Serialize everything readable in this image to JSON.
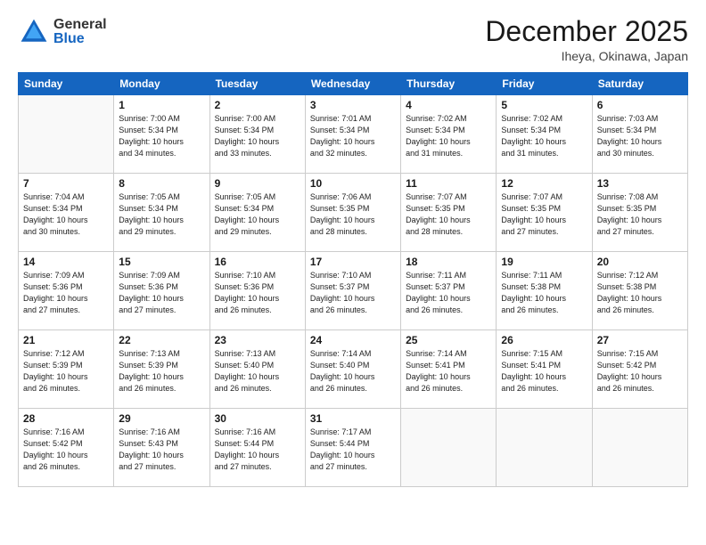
{
  "header": {
    "logo_general": "General",
    "logo_blue": "Blue",
    "month": "December 2025",
    "location": "Iheya, Okinawa, Japan"
  },
  "days_of_week": [
    "Sunday",
    "Monday",
    "Tuesday",
    "Wednesday",
    "Thursday",
    "Friday",
    "Saturday"
  ],
  "weeks": [
    [
      {
        "day": "",
        "info": ""
      },
      {
        "day": "1",
        "info": "Sunrise: 7:00 AM\nSunset: 5:34 PM\nDaylight: 10 hours\nand 34 minutes."
      },
      {
        "day": "2",
        "info": "Sunrise: 7:00 AM\nSunset: 5:34 PM\nDaylight: 10 hours\nand 33 minutes."
      },
      {
        "day": "3",
        "info": "Sunrise: 7:01 AM\nSunset: 5:34 PM\nDaylight: 10 hours\nand 32 minutes."
      },
      {
        "day": "4",
        "info": "Sunrise: 7:02 AM\nSunset: 5:34 PM\nDaylight: 10 hours\nand 31 minutes."
      },
      {
        "day": "5",
        "info": "Sunrise: 7:02 AM\nSunset: 5:34 PM\nDaylight: 10 hours\nand 31 minutes."
      },
      {
        "day": "6",
        "info": "Sunrise: 7:03 AM\nSunset: 5:34 PM\nDaylight: 10 hours\nand 30 minutes."
      }
    ],
    [
      {
        "day": "7",
        "info": "Sunrise: 7:04 AM\nSunset: 5:34 PM\nDaylight: 10 hours\nand 30 minutes."
      },
      {
        "day": "8",
        "info": "Sunrise: 7:05 AM\nSunset: 5:34 PM\nDaylight: 10 hours\nand 29 minutes."
      },
      {
        "day": "9",
        "info": "Sunrise: 7:05 AM\nSunset: 5:34 PM\nDaylight: 10 hours\nand 29 minutes."
      },
      {
        "day": "10",
        "info": "Sunrise: 7:06 AM\nSunset: 5:35 PM\nDaylight: 10 hours\nand 28 minutes."
      },
      {
        "day": "11",
        "info": "Sunrise: 7:07 AM\nSunset: 5:35 PM\nDaylight: 10 hours\nand 28 minutes."
      },
      {
        "day": "12",
        "info": "Sunrise: 7:07 AM\nSunset: 5:35 PM\nDaylight: 10 hours\nand 27 minutes."
      },
      {
        "day": "13",
        "info": "Sunrise: 7:08 AM\nSunset: 5:35 PM\nDaylight: 10 hours\nand 27 minutes."
      }
    ],
    [
      {
        "day": "14",
        "info": "Sunrise: 7:09 AM\nSunset: 5:36 PM\nDaylight: 10 hours\nand 27 minutes."
      },
      {
        "day": "15",
        "info": "Sunrise: 7:09 AM\nSunset: 5:36 PM\nDaylight: 10 hours\nand 27 minutes."
      },
      {
        "day": "16",
        "info": "Sunrise: 7:10 AM\nSunset: 5:36 PM\nDaylight: 10 hours\nand 26 minutes."
      },
      {
        "day": "17",
        "info": "Sunrise: 7:10 AM\nSunset: 5:37 PM\nDaylight: 10 hours\nand 26 minutes."
      },
      {
        "day": "18",
        "info": "Sunrise: 7:11 AM\nSunset: 5:37 PM\nDaylight: 10 hours\nand 26 minutes."
      },
      {
        "day": "19",
        "info": "Sunrise: 7:11 AM\nSunset: 5:38 PM\nDaylight: 10 hours\nand 26 minutes."
      },
      {
        "day": "20",
        "info": "Sunrise: 7:12 AM\nSunset: 5:38 PM\nDaylight: 10 hours\nand 26 minutes."
      }
    ],
    [
      {
        "day": "21",
        "info": "Sunrise: 7:12 AM\nSunset: 5:39 PM\nDaylight: 10 hours\nand 26 minutes."
      },
      {
        "day": "22",
        "info": "Sunrise: 7:13 AM\nSunset: 5:39 PM\nDaylight: 10 hours\nand 26 minutes."
      },
      {
        "day": "23",
        "info": "Sunrise: 7:13 AM\nSunset: 5:40 PM\nDaylight: 10 hours\nand 26 minutes."
      },
      {
        "day": "24",
        "info": "Sunrise: 7:14 AM\nSunset: 5:40 PM\nDaylight: 10 hours\nand 26 minutes."
      },
      {
        "day": "25",
        "info": "Sunrise: 7:14 AM\nSunset: 5:41 PM\nDaylight: 10 hours\nand 26 minutes."
      },
      {
        "day": "26",
        "info": "Sunrise: 7:15 AM\nSunset: 5:41 PM\nDaylight: 10 hours\nand 26 minutes."
      },
      {
        "day": "27",
        "info": "Sunrise: 7:15 AM\nSunset: 5:42 PM\nDaylight: 10 hours\nand 26 minutes."
      }
    ],
    [
      {
        "day": "28",
        "info": "Sunrise: 7:16 AM\nSunset: 5:42 PM\nDaylight: 10 hours\nand 26 minutes."
      },
      {
        "day": "29",
        "info": "Sunrise: 7:16 AM\nSunset: 5:43 PM\nDaylight: 10 hours\nand 27 minutes."
      },
      {
        "day": "30",
        "info": "Sunrise: 7:16 AM\nSunset: 5:44 PM\nDaylight: 10 hours\nand 27 minutes."
      },
      {
        "day": "31",
        "info": "Sunrise: 7:17 AM\nSunset: 5:44 PM\nDaylight: 10 hours\nand 27 minutes."
      },
      {
        "day": "",
        "info": ""
      },
      {
        "day": "",
        "info": ""
      },
      {
        "day": "",
        "info": ""
      }
    ]
  ]
}
